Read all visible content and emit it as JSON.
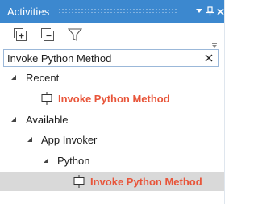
{
  "panel": {
    "title": "Activities"
  },
  "toolbar": {
    "expand_all_icon": "expand-all-icon",
    "collapse_all_icon": "collapse-all-icon",
    "filter_icon": "filter-icon"
  },
  "search": {
    "value": "Invoke Python Method"
  },
  "tree": {
    "recent": {
      "label": "Recent",
      "items": [
        {
          "label": "Invoke Python Method"
        }
      ]
    },
    "available": {
      "label": "Available",
      "app_invoker": {
        "label": "App Invoker",
        "python": {
          "label": "Python",
          "items": [
            {
              "label": "Invoke Python Method"
            }
          ]
        }
      }
    }
  },
  "colors": {
    "titlebar": "#3c88cf",
    "activity_text": "#e8553a",
    "selected_row": "#d9d9d9"
  }
}
